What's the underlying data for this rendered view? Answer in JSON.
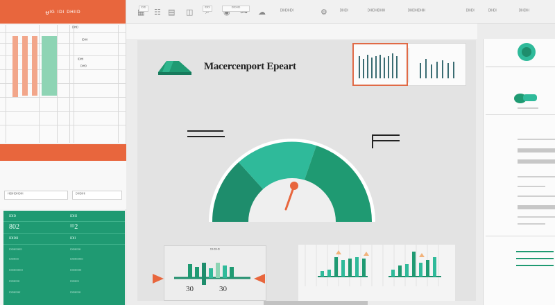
{
  "left_pane": {
    "header_title": "ᵾᴵᴳ ᴵᴰᴵ ᴰᴴᴵᴵᴰ",
    "top_labels": [
      "ᴰᴵᴴᴰ",
      "ᴵᴰᴵᴴᴵ"
    ],
    "mid_field_1": "ᴴᴵᴰᴵᴴᴰᴵᴴᴰᴵᴴ",
    "mid_field_2": "ᴰᴵᴴᴰᴵᴴᴵ",
    "table": {
      "header": [
        "ᴵᴰᴵᴰ",
        "ᴵᴰᴴᴵ"
      ],
      "row1": [
        "802",
        "ᴵᴰ2"
      ],
      "row2": [
        "ᴵᴰᴵᴰᴵᴵ",
        "ᴵᴰᴵᴵ"
      ],
      "small_rows": [
        "ᴵᴰᴵᴰᴴᴵᴰᴴᴵᴰ",
        "ᴵᴰᴵᴰᴴᴵᴰᴵ",
        "ᴵᴰᴵᴰᴴᴵᴰᴴᴵᴰᴵ",
        "ᴵᴰᴵᴰᴴᴵᴰᴴ",
        "ᴵᴰᴵᴰᴴᴵᴰᴴᴵ"
      ],
      "small_rows_2": [
        "ᴵᴰᴵᴰᴴᴵᴰᴴ",
        "ᴵᴰᴵᴰᴴᴵᴰᴴᴵᴰ",
        "ᴵᴰᴵᴰᴴᴵᴰᴴᴵ",
        "ᴵᴰᴵᴰᴴᴵᴰ",
        "ᴵᴰᴵᴰᴴᴵᴰᴴ"
      ]
    }
  },
  "toolbar": {
    "icons": [
      "table-icon",
      "sliders-icon",
      "grid-icon",
      "layers-icon",
      "search-icon",
      "eye-icon",
      "link-icon",
      "cloud-icon",
      "settings-icon"
    ],
    "labels": [
      "ᴰᴵᴴᴰᴵᴴᴰᴵ",
      "ᴰᴴᴵᴰᴴᴵᴰᴴᴵᴴ",
      "ᴰᴵᴴᴰᴵ",
      "ᴰᴵᴴᴰᴵ",
      "ᴰᴵᴴᴰᴵᴴ"
    ]
  },
  "subtoolbar": {
    "buttons": [
      "ᴵᴰᴵᴰ",
      "ᴵᴰᴵᴰᴵ",
      "ᴵᴰᴵᴰᴴᴵᴰ"
    ]
  },
  "report": {
    "title": "Macercenport Epeart",
    "gauge_value_fraction": 0.78
  },
  "panel_bar": {
    "title": "ᴰᴵᴴᴰᴵᴴᴰ",
    "left_value": "30",
    "right_value": "30"
  },
  "colors": {
    "accent_orange": "#e8663d",
    "teal_dark": "#1e8d6c",
    "teal_mid": "#24a582",
    "teal_light": "#3cc2a2"
  }
}
